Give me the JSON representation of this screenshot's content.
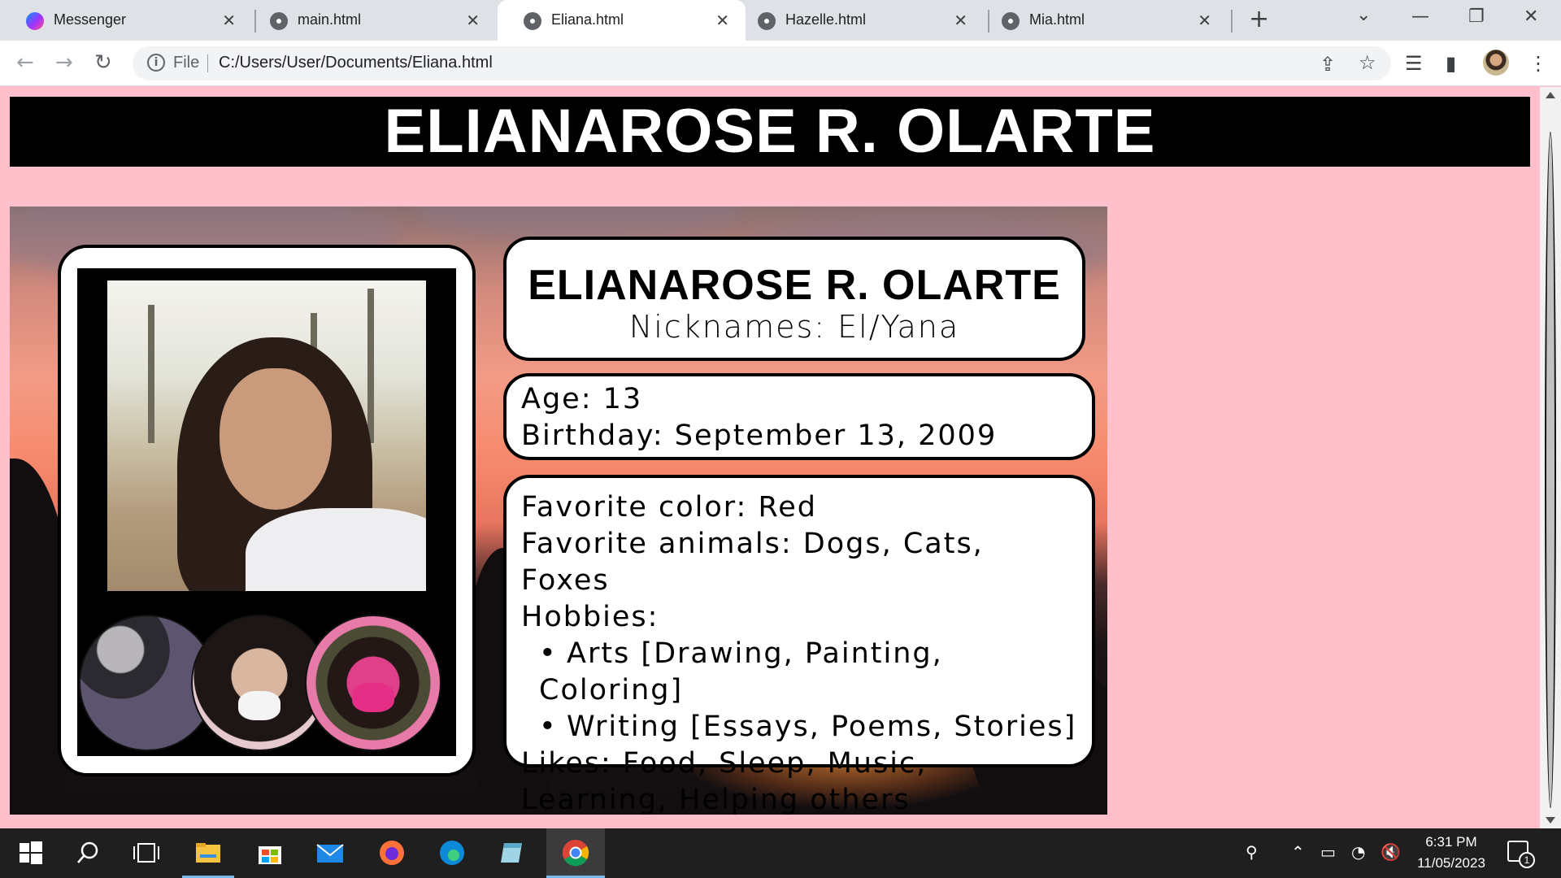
{
  "browser": {
    "tabs": [
      {
        "title": "Messenger",
        "favicon": "messenger-icon",
        "active": false
      },
      {
        "title": "main.html",
        "favicon": "globe-icon",
        "active": false
      },
      {
        "title": "Eliana.html",
        "favicon": "globe-icon",
        "active": true
      },
      {
        "title": "Hazelle.html",
        "favicon": "globe-icon",
        "active": false
      },
      {
        "title": "Mia.html",
        "favicon": "globe-icon",
        "active": false
      }
    ],
    "new_tab_symbol": "+",
    "address": {
      "scheme_label": "File",
      "url": "C:/Users/User/Documents/Eliana.html"
    }
  },
  "page": {
    "header_title": "ELIANAROSE R. OLARTE",
    "profile": {
      "name": "ELIANAROSE R. OLARTE",
      "nicknames": "Nicknames: El/Yana",
      "age": "Age: 13",
      "birthday": "Birthday: September 13, 2009",
      "favorite_color": "Favorite color: Red",
      "favorite_animals": "Favorite animals: Dogs, Cats, Foxes",
      "hobbies_label": "Hobbies:",
      "hobbies": [
        "Arts [Drawing, Painting, Coloring]",
        "Writing [Essays, Poems, Stories]"
      ],
      "likes": "Likes: Food, Sleep, Music, Learning, Helping others"
    },
    "colors": {
      "background": "#ffc0cb",
      "header_bg": "#000000",
      "header_text": "#ffffff"
    }
  },
  "taskbar": {
    "clock_time": "6:31 PM",
    "clock_date": "11/05/2023",
    "notification_count": "1"
  }
}
